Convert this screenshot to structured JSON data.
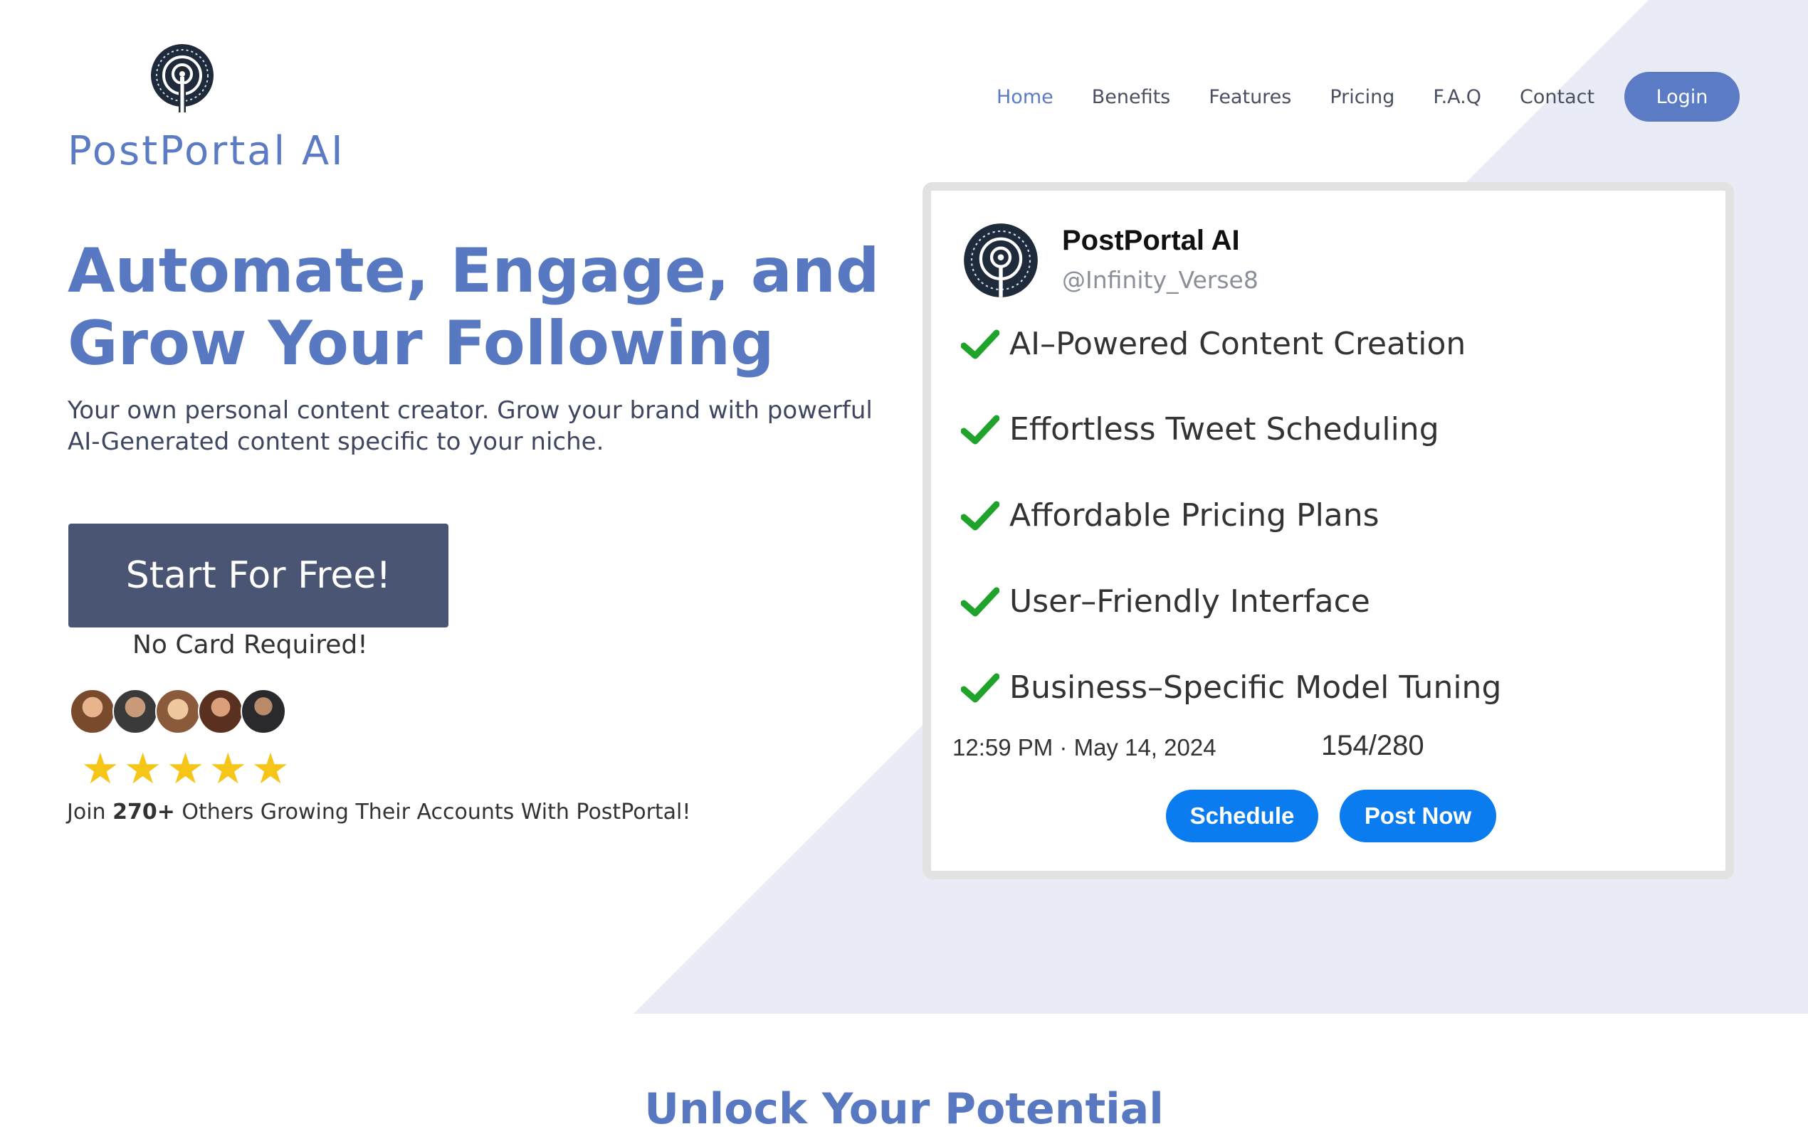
{
  "brand": {
    "name": "PostPortal AI",
    "logo_icon": "portal-spiral-logo"
  },
  "nav": {
    "items": [
      {
        "label": "Home",
        "active": true
      },
      {
        "label": "Benefits",
        "active": false
      },
      {
        "label": "Features",
        "active": false
      },
      {
        "label": "Pricing",
        "active": false
      },
      {
        "label": "F.A.Q",
        "active": false
      },
      {
        "label": "Contact",
        "active": false
      }
    ],
    "login_label": "Login"
  },
  "hero": {
    "title_line1": "Automate, Engage, and",
    "title_line2": "Grow Your Following",
    "subtitle_line1": "Your own personal content creator. Grow your brand with powerful",
    "subtitle_line2": "AI-Generated content specific to your niche.",
    "cta_label": "Start For Free!",
    "no_card": "No Card Required!",
    "stars": "★★★★★",
    "rating": 5,
    "join_prefix": "Join ",
    "join_count": "270+",
    "join_suffix": " Others Growing Their Accounts With PostPortal!"
  },
  "card": {
    "name": "PostPortal AI",
    "handle": "@Infinity_Verse8",
    "features": [
      "AI–Powered Content Creation",
      "Effortless Tweet Scheduling",
      "Affordable Pricing Plans",
      "User–Friendly Interface",
      "Business–Specific Model Tuning"
    ],
    "timestamp": "12:59 PM · May 14, 2024",
    "char_count": "154/280",
    "schedule_label": "Schedule",
    "post_now_label": "Post Now"
  },
  "section": {
    "title": "Unlock Your Potential"
  },
  "colors": {
    "accent": "#5b7bc4",
    "cta_bg": "#4a5573",
    "card_button": "#0a7cf0",
    "check": "#1fa32a",
    "stars": "#f5c518",
    "bg_shape": "#e9ecf6"
  }
}
